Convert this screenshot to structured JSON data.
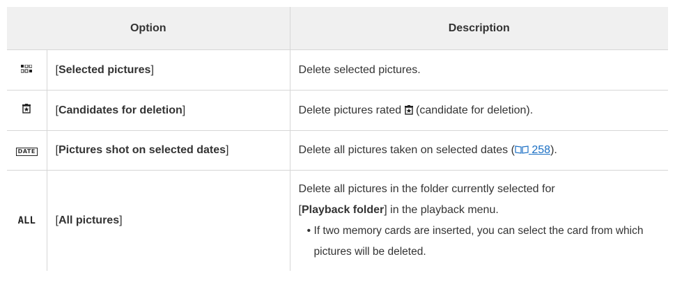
{
  "headers": {
    "option": "Option",
    "description": "Description"
  },
  "rows": [
    {
      "icon": "selected-pictures-icon",
      "opt_pre": "[",
      "opt_bold": "Selected pictures",
      "opt_post": "]",
      "desc": "Delete selected pictures."
    },
    {
      "icon": "candidate-for-deletion-icon",
      "opt_pre": "[",
      "opt_bold": "Candidates for deletion",
      "opt_post": "]",
      "desc_pre": "Delete pictures rated ",
      "desc_post": " (candidate for deletion)."
    },
    {
      "icon": "date-icon",
      "icon_text": "DATE",
      "opt_pre": "[",
      "opt_bold": "Pictures shot on selected dates",
      "opt_post": "]",
      "desc_pre": "Delete all pictures taken on selected dates (",
      "link_page": "258",
      "desc_post": ")."
    },
    {
      "icon_text": "ALL",
      "opt_pre": "[",
      "opt_bold": "All pictures",
      "opt_post": "]",
      "desc_line1": "Delete all pictures in the folder currently selected for",
      "desc_pre": "[",
      "desc_bold": "Playback folder",
      "desc_post": "] in the playback menu.",
      "bullet": "If two memory cards are inserted, you can select the card from which pictures will be deleted."
    }
  ]
}
